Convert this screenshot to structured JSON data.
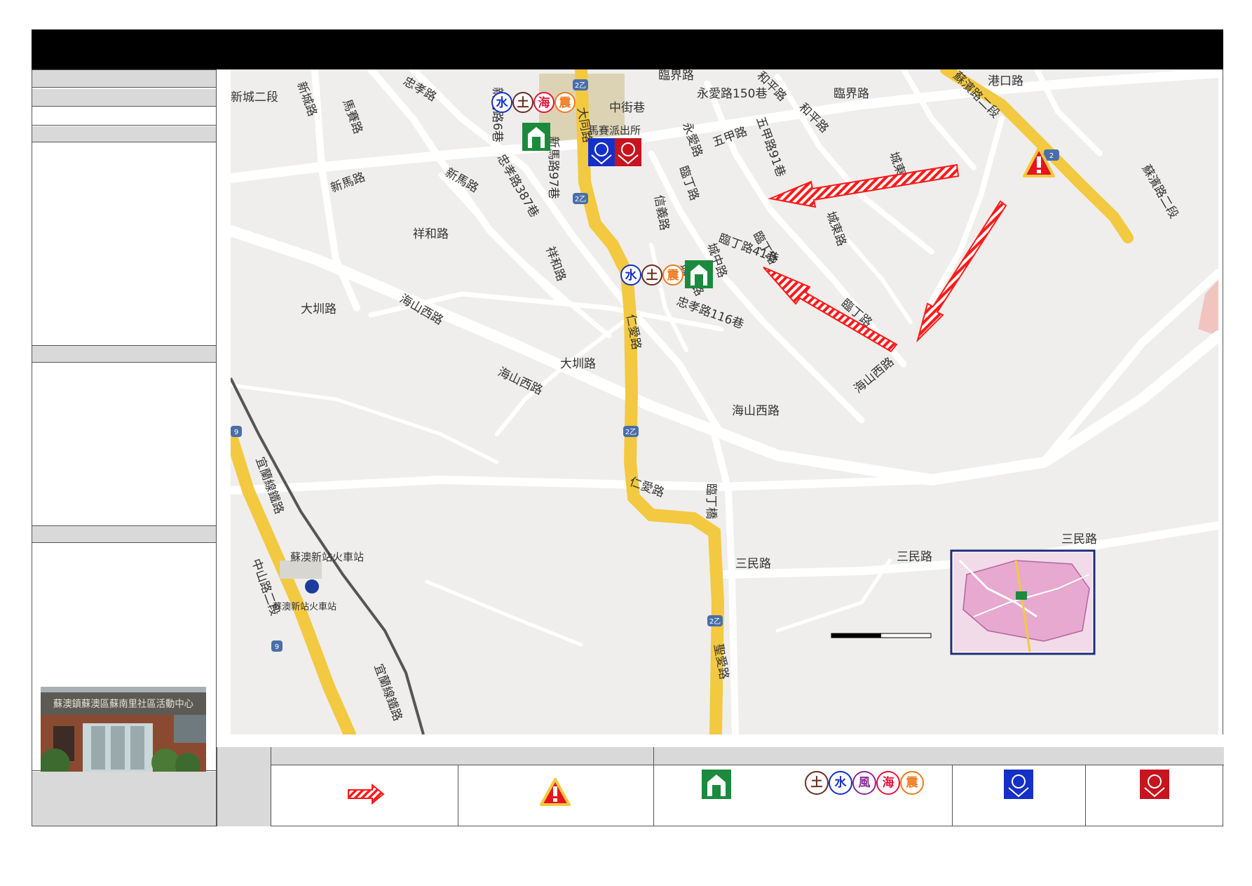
{
  "title": "",
  "sidebar": {
    "photo_caption": "蘇澳鎮蘇澳區蘇南里社區活動中心"
  },
  "map_labels": {
    "roads": [
      "新城二段",
      "新城路",
      "馬賽路",
      "忠孝路",
      "新馬路",
      "祥和路",
      "大圳路",
      "海山西路",
      "仁愛路",
      "大同路",
      "永愛路",
      "五甲路",
      "和平路",
      "臨界路",
      "臨丁路",
      "城東路",
      "蘇濱路二段",
      "港口路",
      "三民路",
      "中山路二段",
      "宜蘭線鐵路",
      "聖愛路",
      "城中路",
      "城南路",
      "信義路",
      "臨丁橋",
      "忠孝路116巷",
      "永愛路150巷",
      "中街巷",
      "新馬路97巷",
      "忠孝路387巷",
      "新馬路6巷",
      "臨丁路41巷",
      "五甲路91巷",
      "和平路"
    ],
    "places": [
      "馬賽派出所",
      "蘇澳新站火車站",
      "蘇澳新站火車站"
    ],
    "route_shields": [
      "2乙",
      "2乙",
      "2乙",
      "2乙",
      "2",
      "9",
      "9"
    ],
    "hazard_tags": [
      "水",
      "土",
      "海",
      "震"
    ]
  },
  "legend": {
    "hazard_icons": [
      "土",
      "水",
      "風",
      "海",
      "震"
    ]
  },
  "colors": {
    "arrow_red": "#ff1a1a",
    "shelter_green": "#1b8a3c",
    "police_blue": "#1530c8",
    "fire_red": "#c8141e",
    "road_yellow": "#f2c940",
    "map_bg": "#efeeec",
    "road_white": "#ffffff"
  }
}
